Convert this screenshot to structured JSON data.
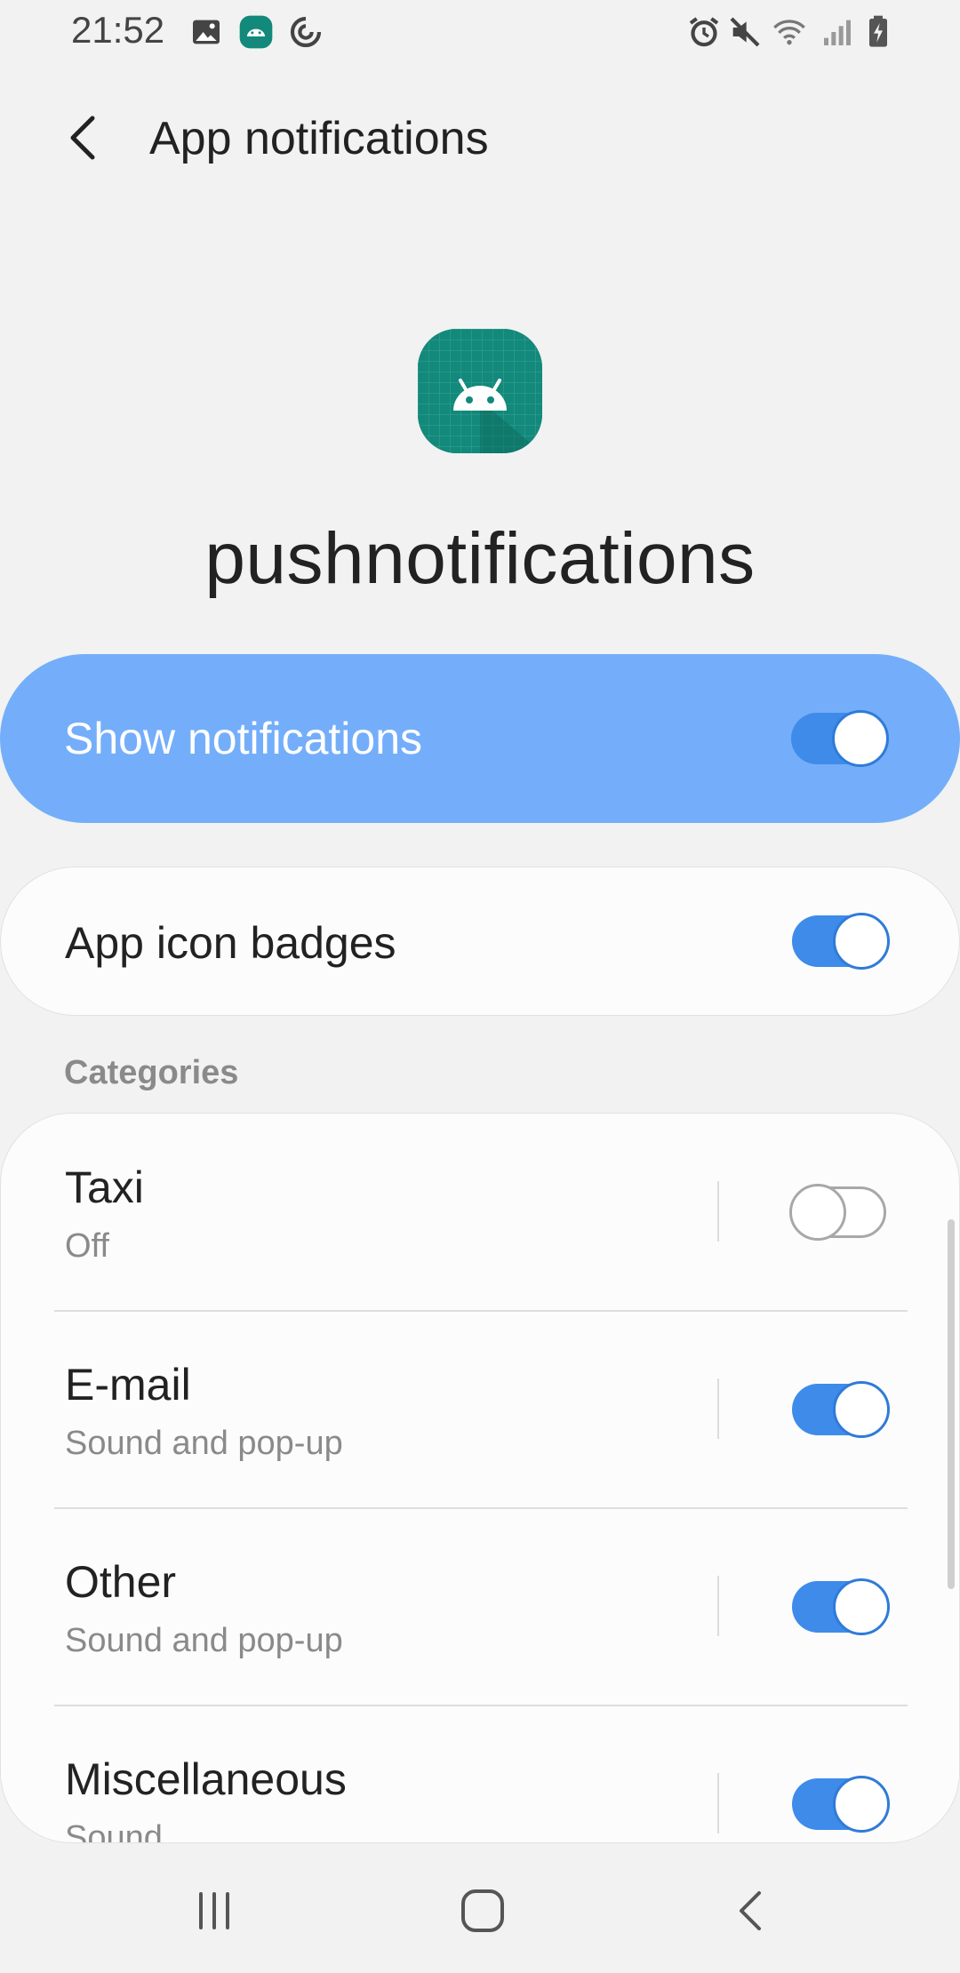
{
  "status_bar": {
    "time": "21:52",
    "left_icons": [
      "image-icon",
      "android-app-icon",
      "sync-icon"
    ],
    "right_icons": [
      "alarm-icon",
      "mute-icon",
      "wifi-icon",
      "signal-icon",
      "battery-charging-icon"
    ]
  },
  "header": {
    "title": "App notifications",
    "back_icon": "back-arrow-icon"
  },
  "app": {
    "name": "pushnotifications",
    "icon": "android-icon",
    "icon_color": "#12897a"
  },
  "show_notifications": {
    "label": "Show notifications",
    "enabled": true,
    "card_color": "#74aefa"
  },
  "app_icon_badges": {
    "label": "App icon badges",
    "enabled": true
  },
  "categories": {
    "title": "Categories",
    "items": [
      {
        "title": "Taxi",
        "subtitle": "Off",
        "enabled": false
      },
      {
        "title": "E-mail",
        "subtitle": "Sound and pop-up",
        "enabled": true
      },
      {
        "title": "Other",
        "subtitle": "Sound and pop-up",
        "enabled": true
      },
      {
        "title": "Miscellaneous",
        "subtitle": "Sound",
        "enabled": true
      }
    ]
  },
  "nav_bar": {
    "icons": [
      "recents-icon",
      "home-icon",
      "back-icon"
    ]
  },
  "colors": {
    "accent": "#3e8bea",
    "background": "#f2f2f2"
  }
}
